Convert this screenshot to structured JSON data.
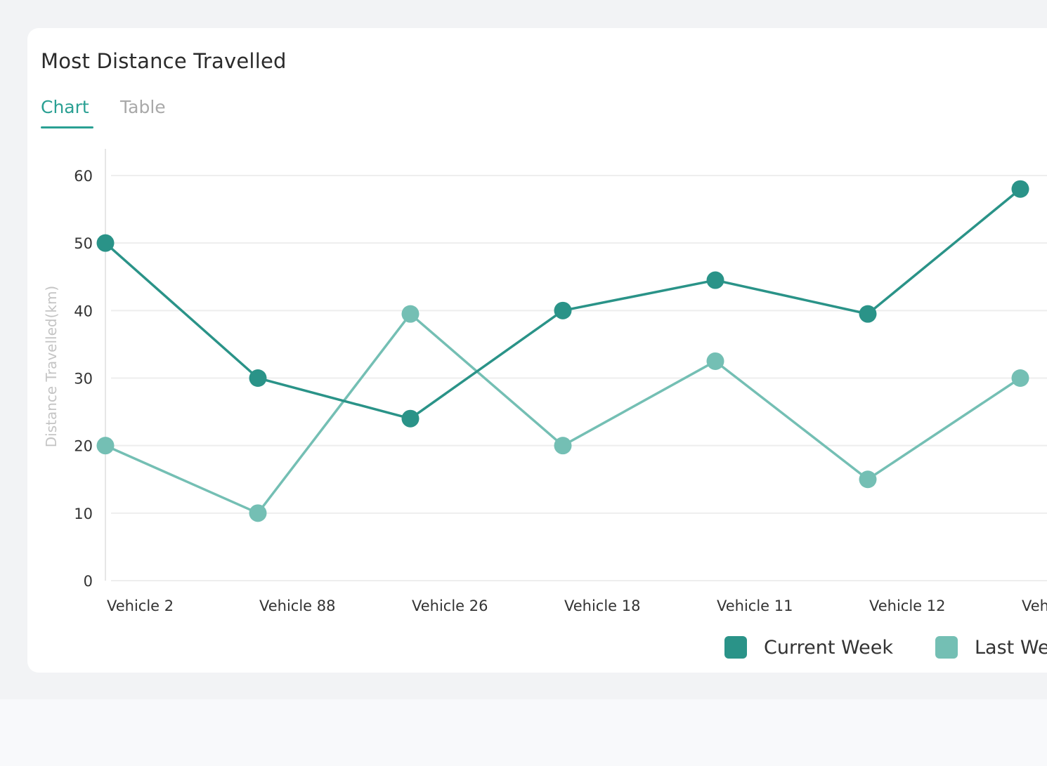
{
  "card": {
    "title": "Most Distance Travelled",
    "tabs": [
      {
        "label": "Chart",
        "active": true
      },
      {
        "label": "Table",
        "active": false
      }
    ]
  },
  "colors": {
    "accent": "#2aa093",
    "current_week": "#2a9388",
    "last_week": "#74bfb4",
    "gridline": "#eeeeee"
  },
  "chart_data": {
    "type": "line",
    "title": "",
    "xlabel": "",
    "ylabel": "Distance Travelled(km)",
    "ylim": [
      0,
      60
    ],
    "yticks": [
      0,
      10,
      20,
      30,
      40,
      50,
      60
    ],
    "grid": true,
    "legend_position": "bottom-right",
    "categories": [
      "Vehicle 2",
      "Vehicle 88",
      "Vehicle 26",
      "Vehicle 18",
      "Vehicle 11",
      "Vehicle 12",
      "Vehic"
    ],
    "series": [
      {
        "name": "Current Week",
        "values": [
          50,
          30,
          24,
          40,
          44.5,
          39.5,
          58
        ]
      },
      {
        "name": "Last We",
        "values": [
          20,
          10,
          39.5,
          20,
          32.5,
          15,
          30
        ]
      }
    ]
  }
}
